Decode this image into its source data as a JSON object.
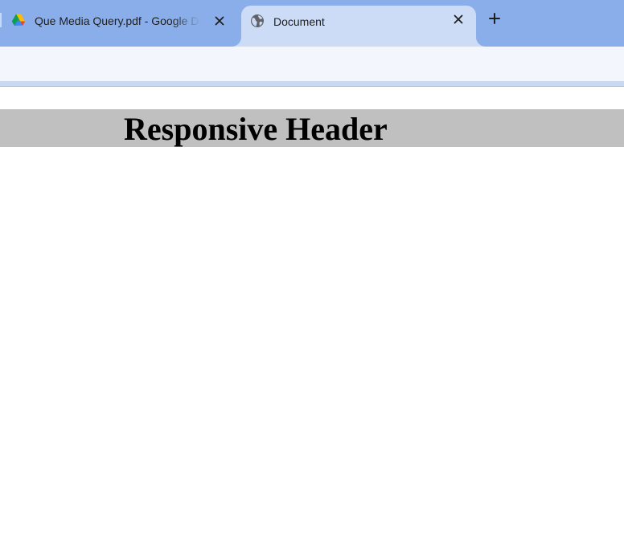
{
  "browser": {
    "tabs": [
      {
        "title": "Que Media Query.pdf - Google Drive",
        "icon": "google-drive-icon",
        "active": false
      },
      {
        "title": "Document",
        "icon": "globe-icon",
        "active": true
      }
    ],
    "new_tab_icon": "plus-icon",
    "close_icon": "close-icon"
  },
  "page": {
    "header_text": "Responsive Header"
  },
  "colors": {
    "tabstrip": "#8aaeea",
    "active_tab": "#ccdcf6",
    "toolbar": "#f3f6fc",
    "header_background": "#c0c0c0"
  }
}
